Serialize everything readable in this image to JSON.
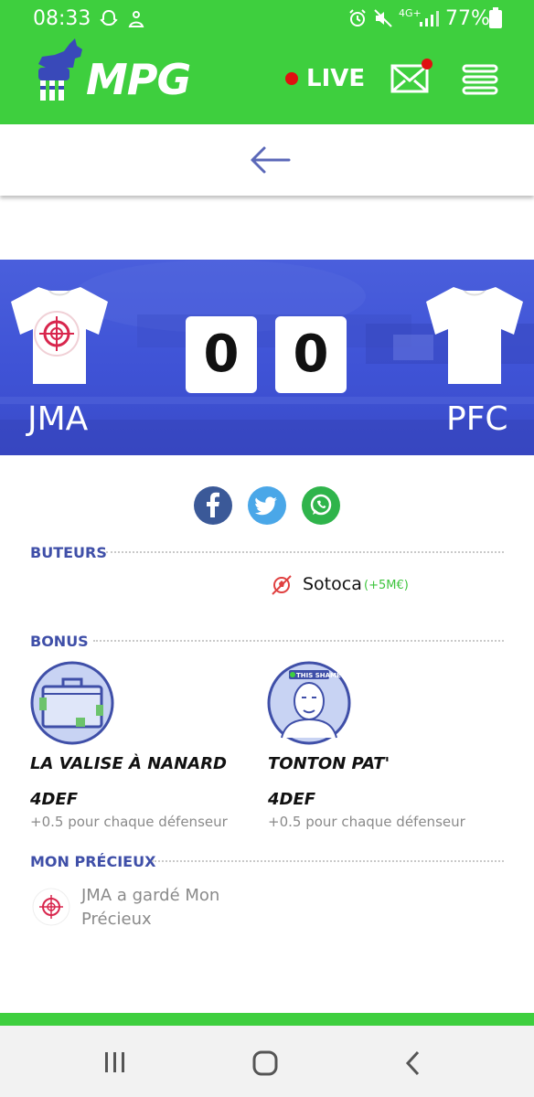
{
  "status_bar": {
    "time": "08:33",
    "network": "4G+",
    "battery": "77%"
  },
  "header": {
    "logo": "MPG",
    "live_label": "LIVE",
    "icons": [
      "goat-logo-icon",
      "live-dot-icon",
      "mail-icon",
      "menu-icon"
    ]
  },
  "match": {
    "home_team": "JMA",
    "away_team": "PFC",
    "home_score": "0",
    "away_score": "0"
  },
  "share_icons": [
    "facebook-icon",
    "twitter-icon",
    "whatsapp-icon"
  ],
  "buteurs": {
    "title": "BUTEURS",
    "scorer_name": "Sotoca",
    "scorer_value": "(+5M€)"
  },
  "bonus": {
    "title": "BONUS",
    "items": [
      {
        "name": "LA VALISE À NANARD",
        "position": "4DEF",
        "description": "+0.5 pour chaque défenseur"
      },
      {
        "name": "TONTON PAT'",
        "position": "4DEF",
        "description": "+0.5 pour chaque défenseur",
        "badge_text": "THIS SHAME"
      }
    ]
  },
  "mon_precieux": {
    "title": "MON PRÉCIEUX",
    "text": "JMA a gardé Mon Précieux"
  },
  "colors": {
    "brand_green": "#3ecf3e",
    "banner_blue": "#4259d9",
    "section_blue": "#3f4fa8",
    "live_red": "#e01010"
  }
}
